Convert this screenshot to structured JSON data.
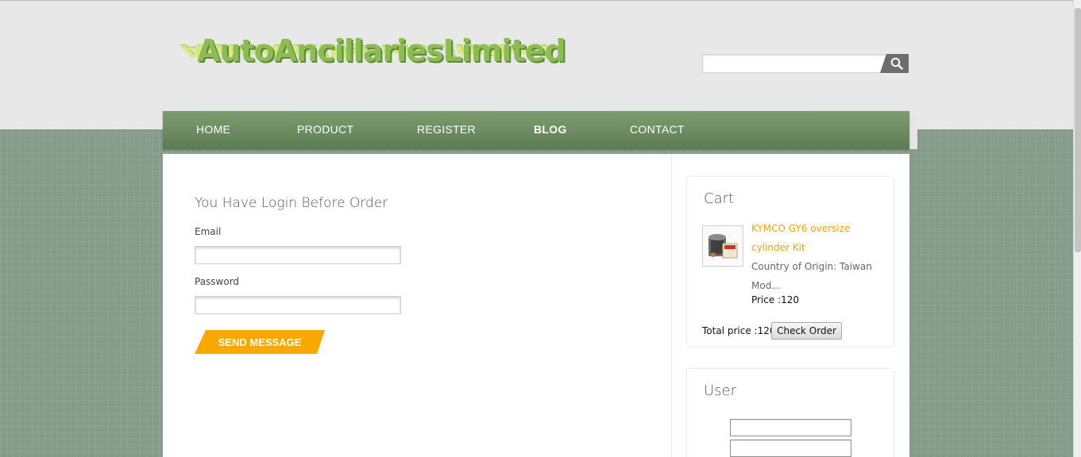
{
  "site": {
    "logo_text": "AutoAncillariesLimited",
    "search": {
      "value": "",
      "placeholder": ""
    }
  },
  "nav": {
    "items": [
      {
        "label": "HOME",
        "active": false
      },
      {
        "label": "PRODUCT",
        "active": false
      },
      {
        "label": "REGISTER",
        "active": false
      },
      {
        "label": "BLOG",
        "active": true
      },
      {
        "label": "CONTACT",
        "active": false
      }
    ]
  },
  "login_form": {
    "title": "You Have Login Before Order",
    "email_label": "Email",
    "email_value": "",
    "password_label": "Password",
    "password_value": "",
    "submit_label": "SEND MESSAGE"
  },
  "cart": {
    "title": "Cart",
    "item": {
      "name": "KYMCO GY6 oversize cylinder Kit",
      "description": "Country of Origin: Taiwan Mod...",
      "price": "Price :120"
    },
    "total": "Total price :120",
    "check_order_label": "Check Order"
  },
  "user_widget": {
    "title": "User",
    "field1_value": "",
    "field2_value": ""
  },
  "colors": {
    "accent_orange": "#f9a800",
    "nav_green": "#6e8d62",
    "logo_green": "#8dbb54",
    "background_green": "#869c8a"
  },
  "icons": {
    "search": "magnifier-icon",
    "product": "cylinder-kit-thumbnail"
  }
}
